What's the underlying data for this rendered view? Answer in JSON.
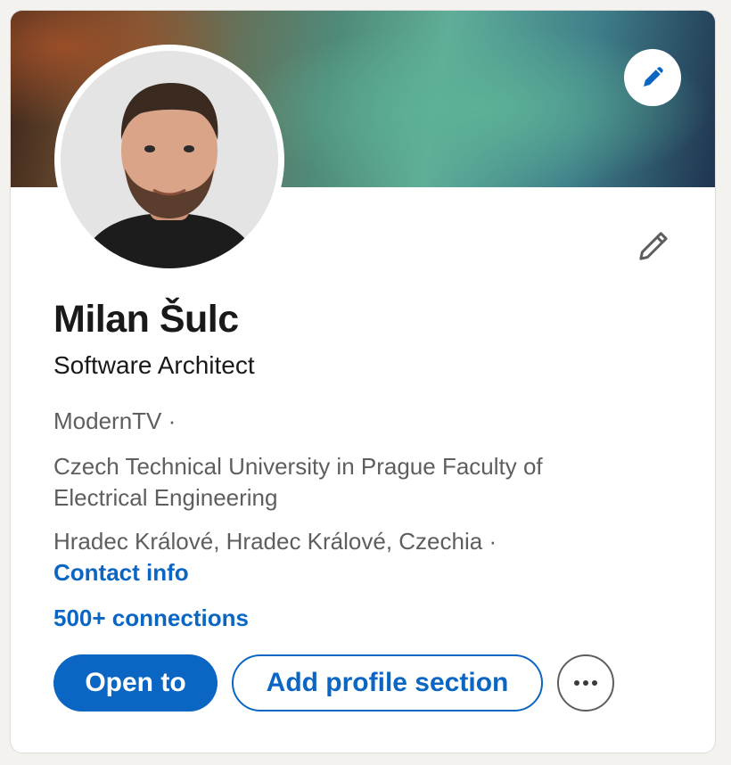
{
  "profile": {
    "name": "Milan Šulc",
    "headline": "Software Architect",
    "company": "ModernTV",
    "separator": "·",
    "school": "Czech Technical University in Prague Faculty of Electrical Engineering",
    "location": "Hradec Králové, Hradec Králové, Czechia",
    "contact_label": "Contact info",
    "connections_label": "500+ connections"
  },
  "actions": {
    "open_to": "Open to",
    "add_section": "Add profile section",
    "more_icon": "ellipsis-icon"
  },
  "icons": {
    "banner_edit": "pencil-icon",
    "profile_edit": "pencil-icon",
    "avatar": "profile-photo"
  },
  "colors": {
    "accent": "#0a66c2",
    "text_primary": "#191919",
    "text_muted": "#5e5e5e"
  }
}
